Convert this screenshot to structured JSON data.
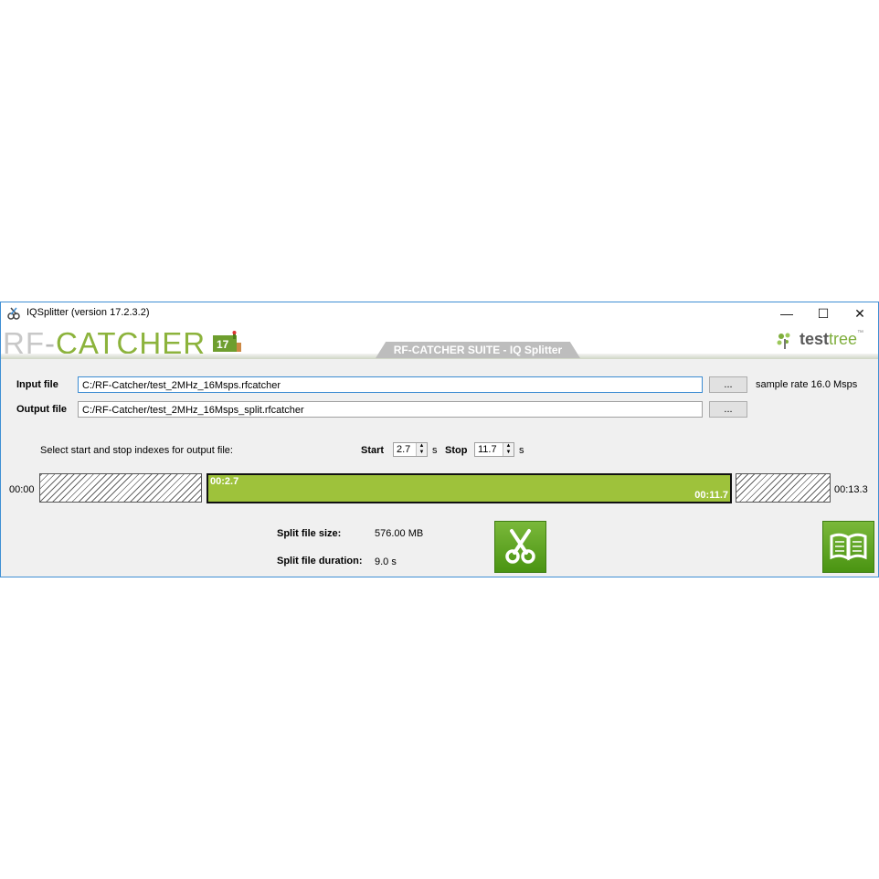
{
  "window": {
    "title": "IQSplitter (version 17.2.3.2)",
    "minimize": "—",
    "maximize": "☐",
    "close": "✕"
  },
  "banner": {
    "logo_rf": "RF",
    "logo_dash": "-",
    "logo_catcher": "CATCHER",
    "badge_text": "17",
    "tab_title": "RF-CATCHER SUITE - IQ Splitter",
    "brand_test": "test",
    "brand_tree": "tree",
    "brand_tm": "™"
  },
  "form": {
    "input_label": "Input file",
    "input_value": "C:/RF-Catcher/test_2MHz_16Msps.rfcatcher",
    "output_label": "Output file",
    "output_value": "C:/RF-Catcher/test_2MHz_16Msps_split.rfcatcher",
    "browse_label": "...",
    "sample_rate": "sample rate 16.0 Msps"
  },
  "selection": {
    "instruction": "Select start and stop indexes for output file:",
    "start_label": "Start",
    "start_value": "2.7",
    "stop_label": "Stop",
    "stop_value": "11.7",
    "unit": "s"
  },
  "timeline": {
    "begin": "00:00",
    "end": "00:13.3",
    "range_start": "00:2.7",
    "range_end": "00:11.7"
  },
  "info": {
    "size_label": "Split file size:",
    "size_value": "576.00 MB",
    "duration_label": "Split file duration:",
    "duration_value": "9.0 s"
  },
  "icons": {
    "split_button": "scissors-icon",
    "manual_button": "book-icon"
  }
}
